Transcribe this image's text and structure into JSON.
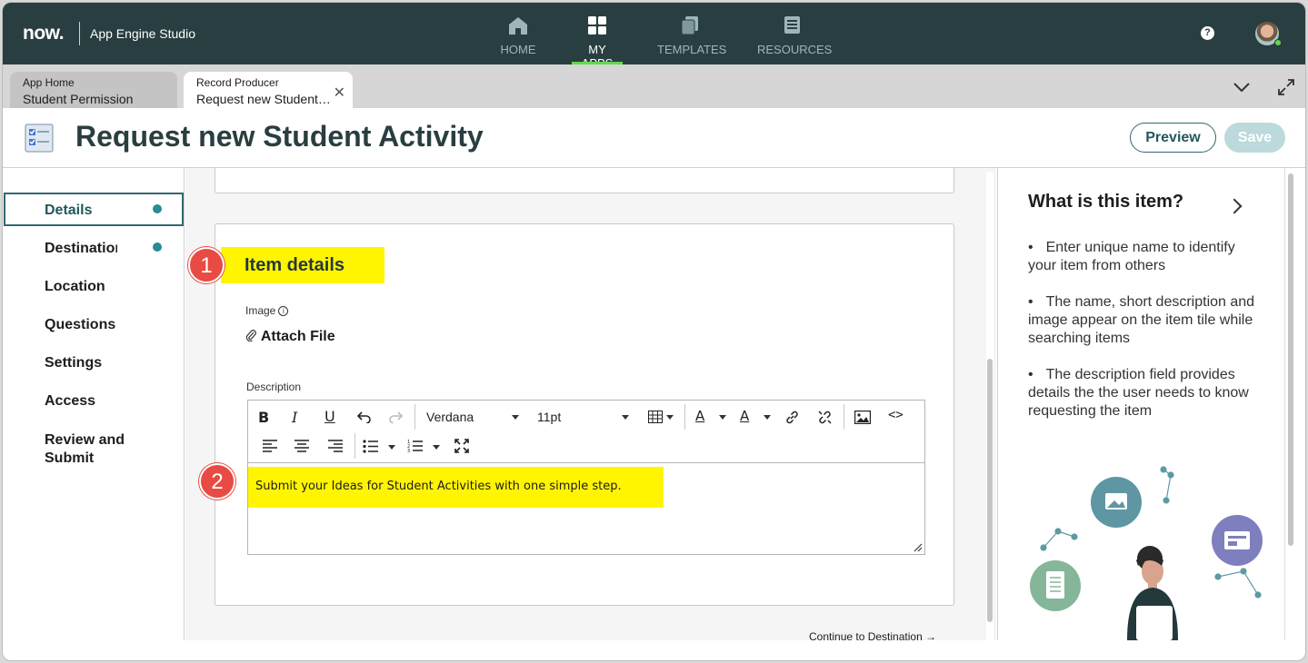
{
  "topnav": {
    "logo": "now.",
    "app_name": "App Engine Studio",
    "items": [
      {
        "label": "HOME",
        "icon": "home-icon"
      },
      {
        "label": "MY APPS",
        "icon": "grid-icon",
        "active": true
      },
      {
        "label": "TEMPLATES",
        "icon": "templates-icon"
      },
      {
        "label": "RESOURCES",
        "icon": "resources-icon"
      }
    ],
    "help": "?"
  },
  "tabs": [
    {
      "type": "App Home",
      "title": "Student Permission"
    },
    {
      "type": "Record Producer",
      "title": "Request new Student Activity",
      "active": true
    }
  ],
  "header": {
    "title": "Request new Student Activity",
    "preview_label": "Preview",
    "save_label": "Save"
  },
  "leftnav": {
    "items": [
      {
        "label": "Details",
        "active": true,
        "dot": true
      },
      {
        "label": "Destination",
        "dot": true
      },
      {
        "label": "Location"
      },
      {
        "label": "Questions"
      },
      {
        "label": "Settings"
      },
      {
        "label": "Access"
      },
      {
        "label": "Review and Submit"
      }
    ]
  },
  "form": {
    "section_title": "Item details",
    "badge_1": "1",
    "badge_2": "2",
    "image_label": "Image",
    "attach_label": "Attach File",
    "description_label": "Description",
    "editor": {
      "font": "Verdana",
      "size": "11pt",
      "content": "Submit your Ideas for Student Activities with one simple step."
    },
    "continue_label": "Continue to Destination →"
  },
  "rightpanel": {
    "title": "What is this item?",
    "bullets": [
      "Enter unique name to identify your item from others",
      "The name, short description and image appear on the item tile while searching items",
      "The description field provides details the the user needs to know requesting the item"
    ]
  },
  "colors": {
    "nav_bg": "#293e40",
    "accent": "#32676f",
    "highlight": "#fff500",
    "badge": "#e84b43"
  }
}
